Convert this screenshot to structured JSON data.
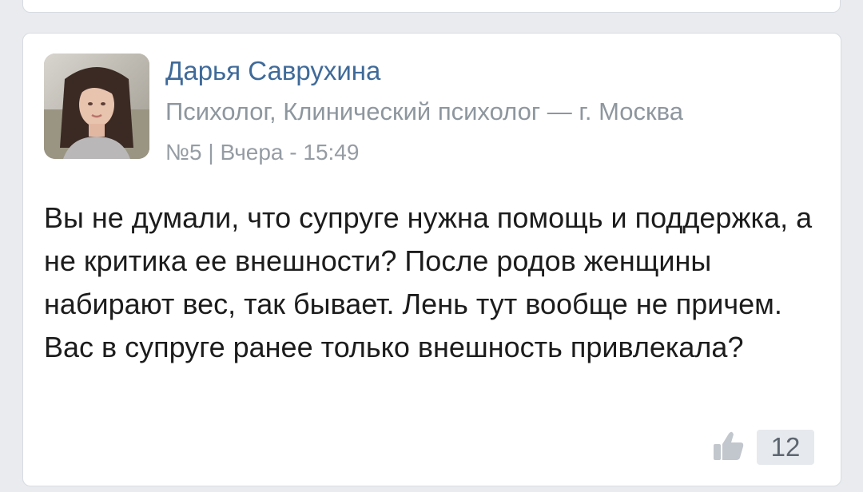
{
  "post": {
    "author_name": "Дарья Саврухина",
    "author_role": "Психолог, Клинический психолог — г. Москва",
    "meta": "№5 | Вчера - 15:49",
    "text": "Вы не думали, что супруге нужна помощь и поддержка, а не критика ее внешности? После родов женщины набирают вес, так бывает. Лень тут вообще не причем. Вас в супруге ранее только внешность привлекала?",
    "like_count": "12",
    "avatar_icon": "profile-photo"
  },
  "colors": {
    "name": "#3f6a99",
    "muted": "#8e969e",
    "body": "#1c1c1c",
    "background": "#e9ebee",
    "card": "#ffffff"
  }
}
